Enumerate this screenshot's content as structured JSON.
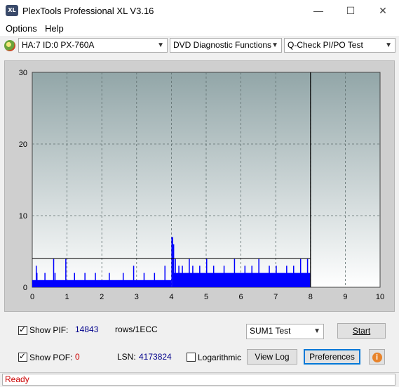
{
  "window": {
    "title": "PlexTools Professional XL V3.16",
    "icon_text": "XL",
    "minimize_glyph": "—",
    "maximize_glyph": "☐",
    "close_glyph": "✕"
  },
  "menu": {
    "items": [
      "Options",
      "Help"
    ]
  },
  "toolbar": {
    "drive": "HA:7 ID:0  PX-760A",
    "function": "DVD Diagnostic Functions",
    "test": "Q-Check PI/PO Test"
  },
  "chart_data": {
    "type": "bar",
    "xlim": [
      0,
      10
    ],
    "ylim": [
      0,
      30
    ],
    "x_ticks": [
      "0",
      "1",
      "2",
      "3",
      "4",
      "5",
      "6",
      "7",
      "8",
      "9",
      "10"
    ],
    "y_ticks": [
      "30",
      "20",
      "10",
      "0"
    ],
    "threshold": 4,
    "data_end_x": 8,
    "grid": "dashed",
    "colors": {
      "bars": "#0000ff",
      "plot_top": "#92a6a8",
      "plot_bottom": "#ffffff",
      "grid": "#5f6e6e"
    },
    "series": [
      {
        "segments": [
          {
            "x": [
              0.0,
              4.0
            ],
            "base": 1,
            "spikes": [
              [
                0.1,
                3
              ],
              [
                0.12,
                2
              ],
              [
                0.35,
                2
              ],
              [
                0.6,
                4
              ],
              [
                0.64,
                2
              ],
              [
                0.95,
                4
              ],
              [
                1.2,
                2
              ],
              [
                1.5,
                2
              ],
              [
                1.8,
                2
              ],
              [
                2.2,
                2
              ],
              [
                2.6,
                2
              ],
              [
                2.9,
                3
              ],
              [
                3.2,
                2
              ],
              [
                3.5,
                2
              ],
              [
                3.8,
                3
              ]
            ]
          },
          {
            "x": [
              4.0,
              4.05
            ],
            "base": 7,
            "spikes": []
          },
          {
            "x": [
              4.05,
              8.0
            ],
            "base": 2,
            "spikes": [
              [
                4.05,
                6
              ],
              [
                4.1,
                4
              ],
              [
                4.2,
                3
              ],
              [
                4.3,
                3
              ],
              [
                4.5,
                4
              ],
              [
                4.6,
                3
              ],
              [
                4.8,
                3
              ],
              [
                5.0,
                4
              ],
              [
                5.2,
                3
              ],
              [
                5.5,
                3
              ],
              [
                5.8,
                4
              ],
              [
                6.1,
                3
              ],
              [
                6.3,
                3
              ],
              [
                6.5,
                4
              ],
              [
                6.8,
                3
              ],
              [
                7.0,
                3
              ],
              [
                7.3,
                3
              ],
              [
                7.5,
                3
              ],
              [
                7.7,
                4
              ],
              [
                7.9,
                4
              ]
            ]
          }
        ]
      }
    ]
  },
  "bottom": {
    "show_pif_label": "Show PIF:",
    "pif_value": "14843",
    "rows_label": "rows/1ECC",
    "sum_combo": "SUM1 Test",
    "start_label": "Start",
    "show_pof_label": "Show POF:",
    "pof_value": "0",
    "lsn_label": "LSN:",
    "lsn_value": "4173824",
    "log_label": "Logarithmic",
    "view_log_label": "View Log",
    "prefs_label": "Preferences",
    "info_glyph": "i"
  },
  "status": {
    "text": "Ready"
  }
}
